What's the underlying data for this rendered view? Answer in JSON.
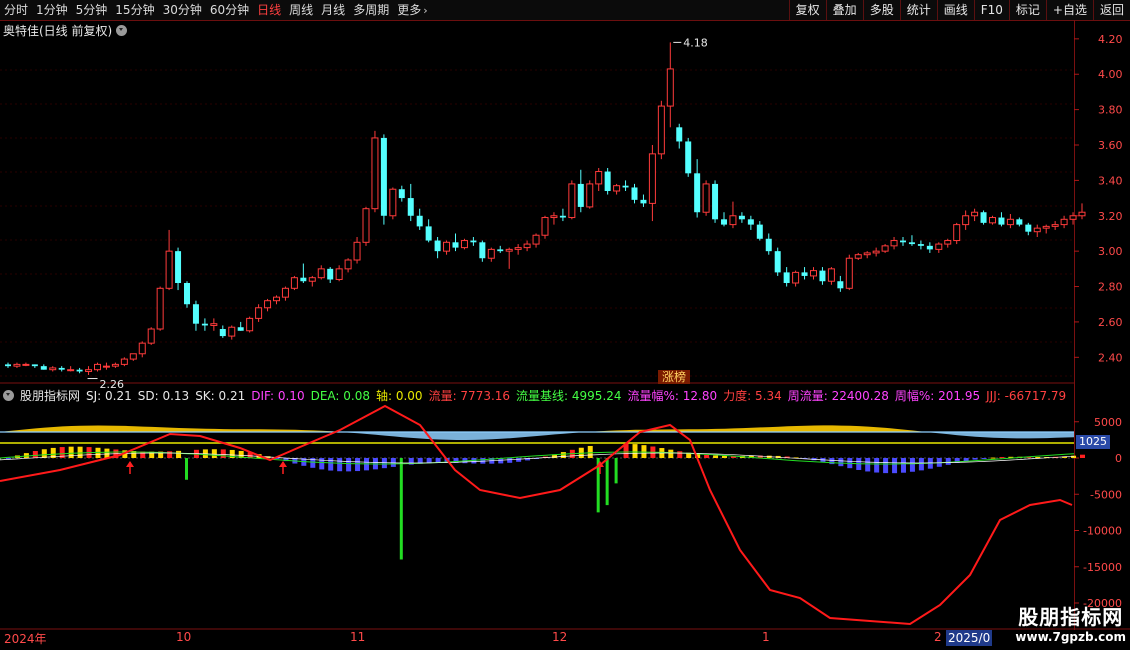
{
  "toolbar": {
    "periods": [
      "分时",
      "1分钟",
      "5分钟",
      "15分钟",
      "30分钟",
      "60分钟",
      "日线",
      "周线",
      "月线",
      "多周期",
      "更多"
    ],
    "active_index": 6,
    "right_buttons": [
      "复权",
      "叠加",
      "多股",
      "统计",
      "画线",
      "F10",
      "标记",
      "+自选",
      "返回"
    ],
    "more_icon": "chevron-right-icon"
  },
  "main": {
    "title": "奥特佳(日线 前复权)",
    "high_label": "4.18",
    "low_label": "2.26",
    "tag": "涨榜",
    "y_ticks": [
      "4.20",
      "4.00",
      "3.80",
      "3.60",
      "3.40",
      "3.20",
      "3.00",
      "2.80",
      "2.60",
      "2.40"
    ],
    "colors": {
      "up": "#ff3b3b",
      "down": "#54ffff"
    }
  },
  "indicator": {
    "name": "股朋指标网",
    "fields": [
      {
        "label": "SJ: 0.21",
        "color": "#e8e8e8"
      },
      {
        "label": "SD: 0.13",
        "color": "#e8e8e8"
      },
      {
        "label": "SK: 0.21",
        "color": "#e8e8e8"
      },
      {
        "label": "DIF: 0.10",
        "color": "#ff44ff"
      },
      {
        "label": "DEA: 0.08",
        "color": "#44ff44"
      },
      {
        "label": "轴: 0.00",
        "color": "#e8e800"
      },
      {
        "label": "流量: 7773.16",
        "color": "#ff4040"
      },
      {
        "label": "流量基线: 4995.24",
        "color": "#44ff44"
      },
      {
        "label": "流量幅%: 12.80",
        "color": "#ff44ff"
      },
      {
        "label": "力度: 5.34",
        "color": "#ff4040"
      },
      {
        "label": "周流量: 22400.28",
        "color": "#ff44ff"
      },
      {
        "label": "周幅%: 201.95",
        "color": "#ff44ff"
      },
      {
        "label": "JJJ: -66717.79",
        "color": "#ff4040"
      }
    ],
    "y_ticks": [
      "5000",
      "0",
      "-5000",
      "-10000",
      "-15000",
      "-20000"
    ],
    "highlight": "1025"
  },
  "x_axis": {
    "labels": [
      "2024年",
      "10",
      "11",
      "12",
      "1",
      "2"
    ],
    "current": "2025/0"
  },
  "watermark": {
    "line1": "股朋指标网",
    "line2": "www.7gpzb.com"
  },
  "chart_data": {
    "type": "candlestick",
    "y_range": [
      2.3,
      4.25
    ],
    "candles": [
      [
        2.36,
        2.37,
        2.34,
        2.35
      ],
      [
        2.35,
        2.37,
        2.34,
        2.36
      ],
      [
        2.36,
        2.37,
        2.35,
        2.36
      ],
      [
        2.36,
        2.36,
        2.34,
        2.35
      ],
      [
        2.35,
        2.36,
        2.33,
        2.33
      ],
      [
        2.33,
        2.35,
        2.32,
        2.34
      ],
      [
        2.34,
        2.35,
        2.32,
        2.33
      ],
      [
        2.33,
        2.35,
        2.32,
        2.33
      ],
      [
        2.33,
        2.34,
        2.31,
        2.32
      ],
      [
        2.32,
        2.35,
        2.3,
        2.33
      ],
      [
        2.33,
        2.37,
        2.32,
        2.36
      ],
      [
        2.35,
        2.37,
        2.33,
        2.35
      ],
      [
        2.35,
        2.37,
        2.34,
        2.36
      ],
      [
        2.36,
        2.4,
        2.35,
        2.39
      ],
      [
        2.39,
        2.42,
        2.38,
        2.42
      ],
      [
        2.42,
        2.49,
        2.4,
        2.48
      ],
      [
        2.48,
        2.57,
        2.47,
        2.56
      ],
      [
        2.56,
        2.8,
        2.55,
        2.79
      ],
      [
        2.79,
        3.12,
        2.78,
        3.0
      ],
      [
        3.0,
        3.02,
        2.78,
        2.82
      ],
      [
        2.82,
        2.83,
        2.68,
        2.7
      ],
      [
        2.7,
        2.72,
        2.55,
        2.59
      ],
      [
        2.59,
        2.62,
        2.55,
        2.58
      ],
      [
        2.58,
        2.62,
        2.55,
        2.59
      ],
      [
        2.56,
        2.58,
        2.51,
        2.52
      ],
      [
        2.52,
        2.58,
        2.5,
        2.57
      ],
      [
        2.57,
        2.6,
        2.55,
        2.55
      ],
      [
        2.55,
        2.63,
        2.54,
        2.62
      ],
      [
        2.62,
        2.7,
        2.6,
        2.68
      ],
      [
        2.68,
        2.73,
        2.66,
        2.72
      ],
      [
        2.72,
        2.75,
        2.7,
        2.74
      ],
      [
        2.74,
        2.8,
        2.72,
        2.79
      ],
      [
        2.79,
        2.86,
        2.78,
        2.85
      ],
      [
        2.85,
        2.93,
        2.82,
        2.83
      ],
      [
        2.83,
        2.86,
        2.8,
        2.85
      ],
      [
        2.85,
        2.92,
        2.84,
        2.9
      ],
      [
        2.9,
        2.91,
        2.82,
        2.84
      ],
      [
        2.84,
        2.92,
        2.83,
        2.9
      ],
      [
        2.9,
        2.96,
        2.88,
        2.95
      ],
      [
        2.95,
        3.08,
        2.93,
        3.05
      ],
      [
        3.05,
        3.25,
        3.03,
        3.24
      ],
      [
        3.24,
        3.68,
        3.22,
        3.64
      ],
      [
        3.64,
        3.66,
        3.15,
        3.2
      ],
      [
        3.2,
        3.36,
        3.18,
        3.35
      ],
      [
        3.35,
        3.37,
        3.28,
        3.3
      ],
      [
        3.3,
        3.38,
        3.17,
        3.2
      ],
      [
        3.2,
        3.24,
        3.12,
        3.14
      ],
      [
        3.14,
        3.18,
        3.05,
        3.06
      ],
      [
        3.06,
        3.08,
        2.96,
        3.0
      ],
      [
        3.0,
        3.06,
        2.98,
        3.05
      ],
      [
        3.05,
        3.1,
        3.0,
        3.02
      ],
      [
        3.02,
        3.07,
        3.01,
        3.06
      ],
      [
        3.06,
        3.08,
        3.03,
        3.05
      ],
      [
        3.05,
        3.06,
        2.94,
        2.96
      ],
      [
        2.96,
        3.02,
        2.94,
        3.01
      ],
      [
        3.01,
        3.03,
        2.99,
        3.0
      ],
      [
        3.0,
        3.02,
        2.9,
        3.01
      ],
      [
        3.01,
        3.04,
        2.98,
        3.02
      ],
      [
        3.02,
        3.06,
        3.0,
        3.04
      ],
      [
        3.04,
        3.1,
        3.02,
        3.09
      ],
      [
        3.09,
        3.2,
        3.07,
        3.19
      ],
      [
        3.19,
        3.22,
        3.15,
        3.2
      ],
      [
        3.2,
        3.24,
        3.17,
        3.19
      ],
      [
        3.19,
        3.4,
        3.18,
        3.38
      ],
      [
        3.38,
        3.46,
        3.22,
        3.25
      ],
      [
        3.25,
        3.4,
        3.24,
        3.38
      ],
      [
        3.38,
        3.47,
        3.34,
        3.45
      ],
      [
        3.45,
        3.47,
        3.32,
        3.34
      ],
      [
        3.34,
        3.38,
        3.32,
        3.37
      ],
      [
        3.37,
        3.4,
        3.34,
        3.36
      ],
      [
        3.36,
        3.38,
        3.27,
        3.29
      ],
      [
        3.29,
        3.32,
        3.25,
        3.27
      ],
      [
        3.27,
        3.6,
        3.17,
        3.55
      ],
      [
        3.55,
        3.85,
        3.52,
        3.82
      ],
      [
        3.82,
        4.18,
        3.7,
        4.03
      ],
      [
        3.7,
        3.72,
        3.58,
        3.62
      ],
      [
        3.62,
        3.64,
        3.42,
        3.44
      ],
      [
        3.44,
        3.52,
        3.19,
        3.22
      ],
      [
        3.22,
        3.4,
        3.2,
        3.38
      ],
      [
        3.38,
        3.4,
        3.16,
        3.18
      ],
      [
        3.18,
        3.22,
        3.14,
        3.15
      ],
      [
        3.15,
        3.28,
        3.13,
        3.2
      ],
      [
        3.2,
        3.22,
        3.16,
        3.18
      ],
      [
        3.18,
        3.2,
        3.12,
        3.15
      ],
      [
        3.15,
        3.17,
        3.06,
        3.07
      ],
      [
        3.07,
        3.1,
        2.98,
        3.0
      ],
      [
        3.0,
        3.02,
        2.86,
        2.88
      ],
      [
        2.88,
        2.91,
        2.8,
        2.82
      ],
      [
        2.82,
        2.89,
        2.8,
        2.88
      ],
      [
        2.88,
        2.91,
        2.84,
        2.86
      ],
      [
        2.86,
        2.91,
        2.84,
        2.89
      ],
      [
        2.89,
        2.91,
        2.81,
        2.83
      ],
      [
        2.83,
        2.91,
        2.81,
        2.9
      ],
      [
        2.83,
        2.86,
        2.77,
        2.79
      ],
      [
        2.79,
        2.98,
        2.78,
        2.96
      ],
      [
        2.96,
        2.99,
        2.95,
        2.98
      ],
      [
        2.98,
        3.0,
        2.96,
        2.99
      ],
      [
        2.99,
        3.02,
        2.97,
        3.0
      ],
      [
        3.0,
        3.04,
        2.99,
        3.03
      ],
      [
        3.03,
        3.08,
        3.01,
        3.06
      ],
      [
        3.06,
        3.08,
        3.03,
        3.05
      ],
      [
        3.05,
        3.09,
        3.03,
        3.04
      ],
      [
        3.04,
        3.06,
        3.01,
        3.03
      ],
      [
        3.03,
        3.05,
        2.99,
        3.01
      ],
      [
        3.01,
        3.05,
        2.99,
        3.04
      ],
      [
        3.04,
        3.07,
        3.02,
        3.06
      ],
      [
        3.06,
        3.16,
        3.04,
        3.15
      ],
      [
        3.15,
        3.23,
        3.12,
        3.2
      ],
      [
        3.2,
        3.24,
        3.17,
        3.22
      ],
      [
        3.22,
        3.23,
        3.15,
        3.16
      ],
      [
        3.16,
        3.2,
        3.15,
        3.19
      ],
      [
        3.19,
        3.22,
        3.14,
        3.15
      ],
      [
        3.15,
        3.21,
        3.13,
        3.18
      ],
      [
        3.18,
        3.19,
        3.14,
        3.15
      ],
      [
        3.15,
        3.16,
        3.09,
        3.11
      ],
      [
        3.11,
        3.15,
        3.08,
        3.13
      ],
      [
        3.13,
        3.15,
        3.1,
        3.14
      ],
      [
        3.14,
        3.17,
        3.12,
        3.15
      ],
      [
        3.15,
        3.2,
        3.13,
        3.18
      ],
      [
        3.18,
        3.22,
        3.15,
        3.2
      ],
      [
        3.2,
        3.27,
        3.18,
        3.22
      ]
    ]
  }
}
